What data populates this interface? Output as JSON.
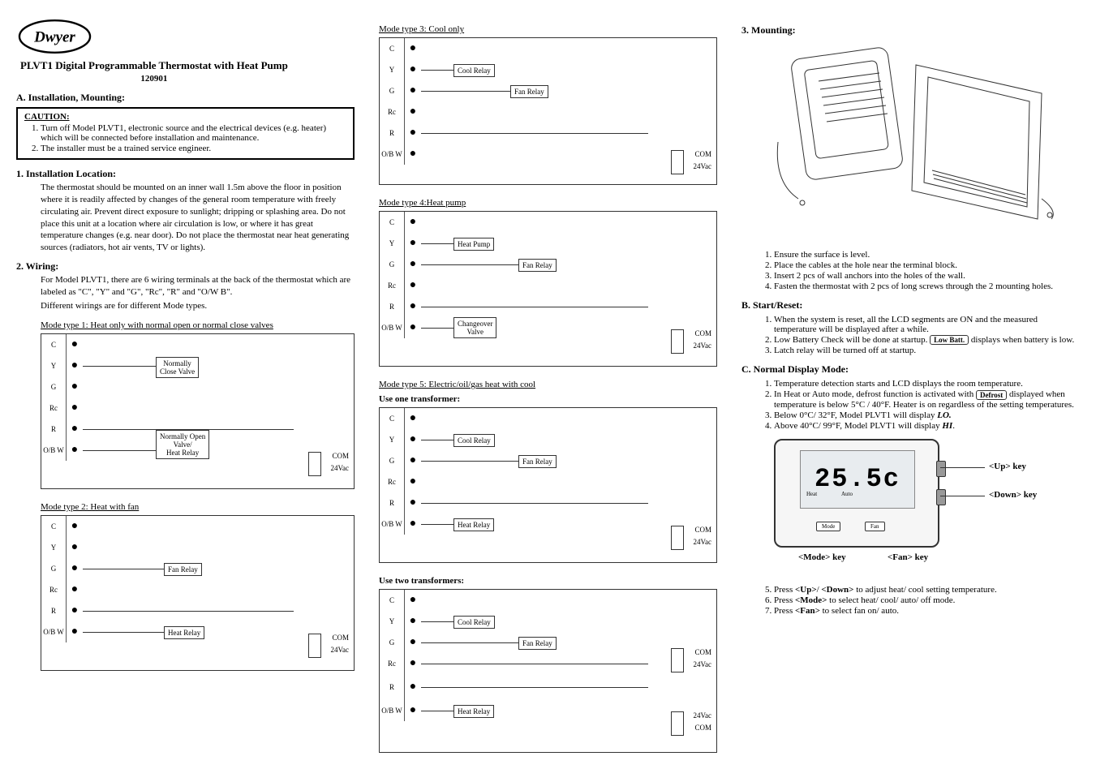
{
  "logo_text": "Dwyer",
  "title": "PLVT1 Digital Programmable Thermostat with Heat Pump",
  "doc_id": "120901",
  "sec_a_title": "A.    Installation, Mounting:",
  "caution_title": "CAUTION:",
  "caution_1": "Turn off Model PLVT1, electronic source and the electrical devices (e.g. heater) which will be connected before installation and maintenance.",
  "caution_2": "The installer must be a trained service engineer.",
  "a1_head": "1.      Installation Location:",
  "a1_para": "The thermostat should be mounted on an inner wall 1.5m above the floor in position where it is readily affected by changes of the general room temperature with freely circulating air. Prevent direct exposure to sunlight; dripping or splashing area. Do not place this unit at a location where air circulation is low, or where it has great temperature changes (e.g. near door). Do not place the thermostat near heat generating sources (radiators, hot air vents, TV or lights).",
  "a2_head": "2.      Wiring:",
  "a2_para1": "For Model PLVT1, there are 6 wiring terminals at the back of the thermostat which are labeled as \"C\", \"Y\" and \"G\", \"Rc\", \"R\" and \"O/W B\".",
  "a2_para2": "Different wirings are for different Mode types.",
  "mode1_caption": "Mode type 1: Heat only with normal open or normal close valves",
  "mode2_caption": "Mode type 2: Heat with fan",
  "mode3_caption": "Mode type 3: Cool only",
  "mode4_caption": "Mode type 4:Heat pump",
  "mode5_caption": "Mode type 5: Electric/oil/gas heat with cool",
  "use_one_tx": "Use one transformer:",
  "use_two_tx": "Use two transformers:",
  "terminals": {
    "c": "C",
    "y": "Y",
    "g": "G",
    "rc": "Rc",
    "r": "R",
    "ow": "O/B W"
  },
  "wire_labels": {
    "norm_close": "Normally\nClose Valve",
    "norm_open": "Normally Open\nValve/\nHeat Relay",
    "fan_relay": "Fan Relay",
    "heat_relay": "Heat Relay",
    "cool_relay": "Cool Relay",
    "heat_pump": "Heat Pump",
    "changeover": "Changeover\nValve"
  },
  "supply": {
    "com": "COM",
    "v24": "24Vac"
  },
  "sec3_title": "3. Mounting:",
  "mount_1": "Ensure the surface is level.",
  "mount_2": "Place the cables at the hole near the terminal block.",
  "mount_3": "Insert 2 pcs of wall anchors into the holes of the wall.",
  "mount_4": "Fasten the thermostat with 2 pcs of long screws through the 2 mounting holes.",
  "sec_b_title": "B.   Start/Reset:",
  "b_1": "When the system is reset, all the LCD segments are ON and the measured temperature will be displayed after a while.",
  "b_2a": "Low Battery Check will be done at startup. ",
  "b_2_badge": "Low Batt.",
  "b_2b": " displays when battery is low.",
  "b_3": "Latch relay will be turned off at startup.",
  "sec_c_title": "C.   Normal Display Mode:",
  "c_1": "Temperature detection starts and LCD displays the room temperature.",
  "c_2a": "In Heat or Auto mode, defrost function is activated with ",
  "c_2_badge": "Defrost",
  "c_2b": " displayed when temperature is below 5°C / 40°F. Heater is on regardless of the setting temperatures.",
  "c_3a": "Below 0°C/ 32°F, Model PLVT1 will display ",
  "c_3b": "LO.",
  "c_4a": "Above 40°C/ 99°F, Model PLVT1 will display ",
  "c_4b": "HI",
  "c_4c": ".",
  "display_temp": "25.5c",
  "display_heat": "Heat",
  "display_auto": "Auto",
  "display_mode_btn": "Mode",
  "display_fan_btn": "Fan",
  "key_up": "<Up> key",
  "key_down": "<Down> key",
  "key_mode": "<Mode> key",
  "key_fan": "<Fan> key",
  "c_5": "Press <Up>/ <Down> to adjust heat/ cool setting temperature.",
  "c_6": "Press <Mode> to select heat/ cool/ auto/ off mode.",
  "c_7": "Press <Fan> to select fan on/ auto."
}
